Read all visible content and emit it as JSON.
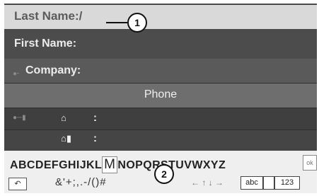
{
  "fields": {
    "last_name_label": "Last Name:",
    "last_name_value": "/",
    "first_name_label": "First Name:",
    "company_label": "Company:",
    "phone_header": "Phone",
    "phone_colon_1": ":",
    "phone_colon_2": ":"
  },
  "icons": {
    "house": "home-icon",
    "house_mobile": "home-mobile-icon",
    "person": "person-icon",
    "contact": "contact-icon"
  },
  "keyboard": {
    "letters_before": "ABCDEFGHIJKL",
    "selected_letter": "M",
    "letters_after": "NOPQRSTUVWXYZ",
    "ok_label": "ok",
    "symbols": "&'+;,.-/()#",
    "abc_label": "abc",
    "num_label": "123"
  },
  "callouts": {
    "one": "1",
    "two": "2"
  }
}
